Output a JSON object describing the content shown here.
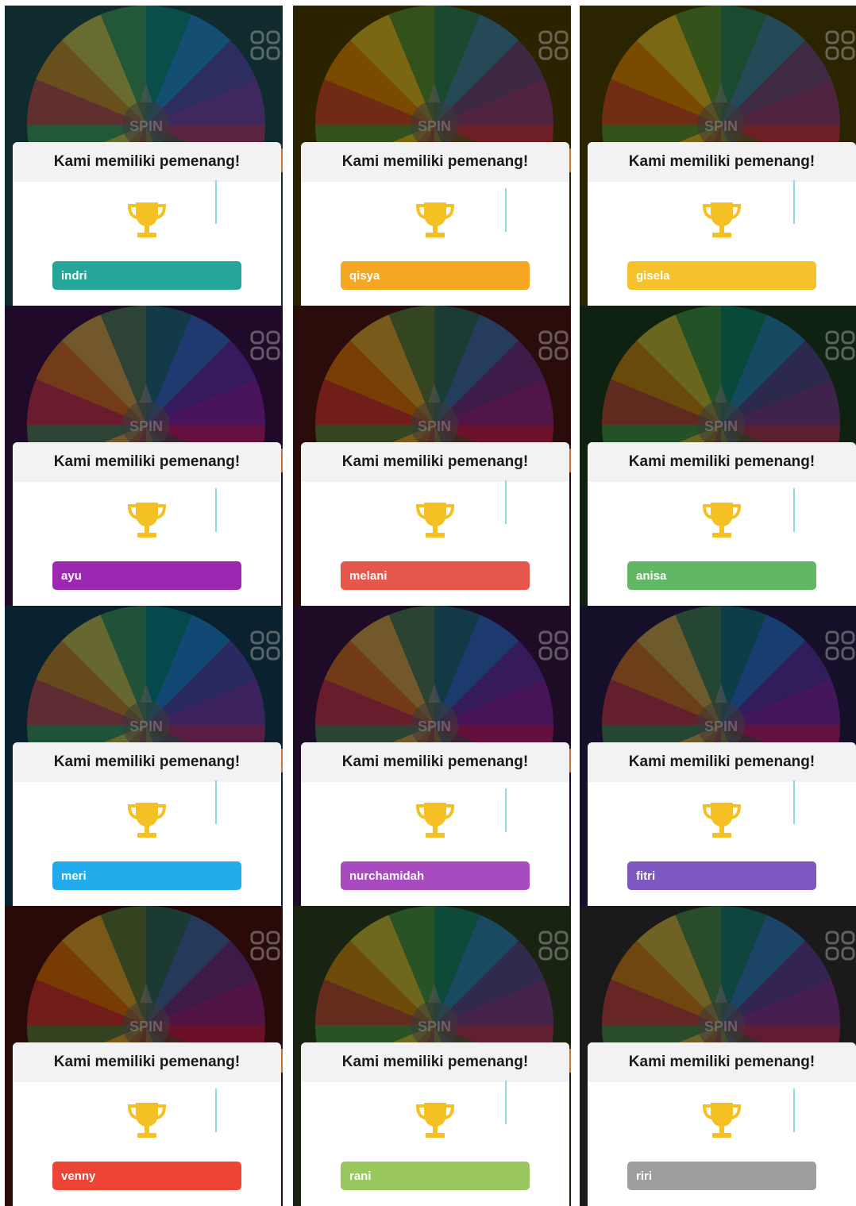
{
  "dialog": {
    "title": "Kami memiliki pemenang!",
    "spin_label": "SPIN"
  },
  "icons": {
    "trophy": "trophy-icon",
    "grid": "grid-icon",
    "wheel": "wheel-icon"
  },
  "colors": {
    "trophy": "#f5c024",
    "card_header": "#f2f2f2"
  },
  "panels": [
    {
      "winner": "indri",
      "bar": "#26a69a",
      "bg": "#0f2b2e"
    },
    {
      "winner": "qisya",
      "bar": "#f5a623",
      "bg": "#2b2200"
    },
    {
      "winner": "gisela",
      "bar": "#f6c22c",
      "bg": "#2b2400"
    },
    {
      "winner": "ayu",
      "bar": "#9c27b0",
      "bg": "#1f0a2a"
    },
    {
      "winner": "melani",
      "bar": "#e5574a",
      "bg": "#2a0d0b"
    },
    {
      "winner": "anisa",
      "bar": "#63b664",
      "bg": "#0f2211"
    },
    {
      "winner": "meri",
      "bar": "#22aaea",
      "bg": "#0a2230"
    },
    {
      "winner": "nurchamidah",
      "bar": "#a84bc0",
      "bg": "#1e0b26"
    },
    {
      "winner": "fitri",
      "bar": "#7e57c2",
      "bg": "#150f29"
    },
    {
      "winner": "venny",
      "bar": "#ee4435",
      "bg": "#2a0a08"
    },
    {
      "winner": "rani",
      "bar": "#99c75d",
      "bg": "#182411"
    },
    {
      "winner": "riri",
      "bar": "#9e9e9e",
      "bg": "#1a1a1a"
    }
  ]
}
